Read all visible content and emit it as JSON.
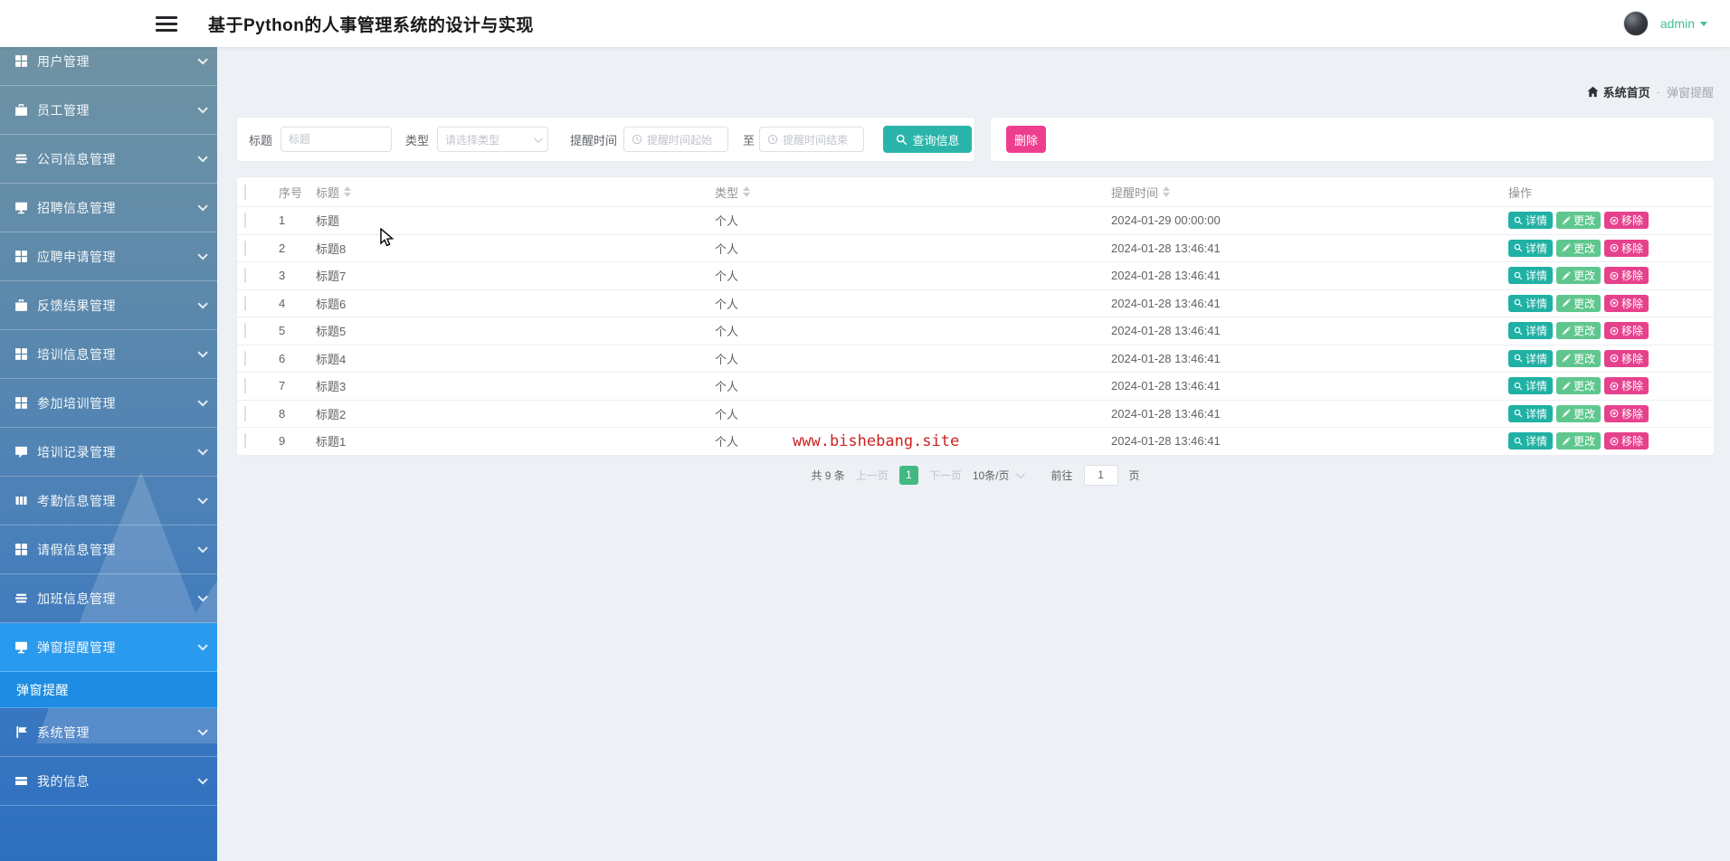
{
  "header": {
    "title": "基于Python的人事管理系统的设计与实现",
    "user": {
      "name": "admin"
    }
  },
  "sidebar": {
    "items": [
      {
        "label": "用户管理",
        "icon": "grid-icon"
      },
      {
        "label": "员工管理",
        "icon": "briefcase-icon"
      },
      {
        "label": "公司信息管理",
        "icon": "list-icon"
      },
      {
        "label": "招聘信息管理",
        "icon": "monitor-icon"
      },
      {
        "label": "应聘申请管理",
        "icon": "grid-icon"
      },
      {
        "label": "反馈结果管理",
        "icon": "briefcase-icon"
      },
      {
        "label": "培训信息管理",
        "icon": "grid-icon"
      },
      {
        "label": "参加培训管理",
        "icon": "grid-icon"
      },
      {
        "label": "培训记录管理",
        "icon": "chat-icon"
      },
      {
        "label": "考勤信息管理",
        "icon": "columns-icon"
      },
      {
        "label": "请假信息管理",
        "icon": "grid-icon"
      },
      {
        "label": "加班信息管理",
        "icon": "list-icon"
      },
      {
        "label": "弹窗提醒管理",
        "icon": "monitor-icon",
        "active": true
      },
      {
        "label": "系统管理",
        "icon": "flag-icon"
      },
      {
        "label": "我的信息",
        "icon": "card-icon"
      }
    ],
    "submenu": {
      "label": "弹窗提醒",
      "active": true
    }
  },
  "breadcrumb": {
    "home": "系统首页",
    "separator": "-",
    "current": "弹窗提醒",
    "home_icon": "home-icon"
  },
  "filters": {
    "title_label": "标题",
    "title_placeholder": "标题",
    "type_label": "类型",
    "type_placeholder": "请选择类型",
    "time_label": "提醒时间",
    "time_start_placeholder": "提醒时间起始",
    "to_label": "至",
    "time_end_placeholder": "提醒时间结束",
    "search_button": "查询信息",
    "delete_button": "删除"
  },
  "table": {
    "columns": [
      "序号",
      "标题",
      "类型",
      "提醒时间",
      "操作"
    ],
    "actions": {
      "detail": "详情",
      "edit": "更改",
      "remove": "移除"
    },
    "rows": [
      {
        "no": "1",
        "title": "标题",
        "type": "个人",
        "time": "2024-01-29 00:00:00"
      },
      {
        "no": "2",
        "title": "标题8",
        "type": "个人",
        "time": "2024-01-28 13:46:41"
      },
      {
        "no": "3",
        "title": "标题7",
        "type": "个人",
        "time": "2024-01-28 13:46:41"
      },
      {
        "no": "4",
        "title": "标题6",
        "type": "个人",
        "time": "2024-01-28 13:46:41"
      },
      {
        "no": "5",
        "title": "标题5",
        "type": "个人",
        "time": "2024-01-28 13:46:41"
      },
      {
        "no": "6",
        "title": "标题4",
        "type": "个人",
        "time": "2024-01-28 13:46:41"
      },
      {
        "no": "7",
        "title": "标题3",
        "type": "个人",
        "time": "2024-01-28 13:46:41"
      },
      {
        "no": "8",
        "title": "标题2",
        "type": "个人",
        "time": "2024-01-28 13:46:41"
      },
      {
        "no": "9",
        "title": "标题1",
        "type": "个人",
        "time": "2024-01-28 13:46:41"
      }
    ],
    "watermark": "www.bishebang.site"
  },
  "pagination": {
    "total": "共 9 条",
    "prev": "上一页",
    "page": "1",
    "next": "下一页",
    "page_size": "10条/页",
    "goto_label": "前往",
    "goto_value": "1",
    "unit": "页"
  },
  "colors": {
    "accent_teal": "#2bb5aa",
    "accent_pink": "#ee3f8e",
    "accent_green": "#42b983",
    "active_menu_blue": "#2a9aee",
    "watermark_red": "#cc2222"
  }
}
